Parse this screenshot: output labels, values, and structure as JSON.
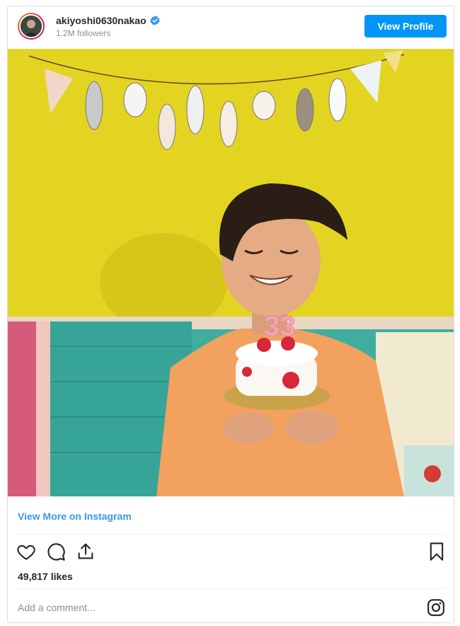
{
  "header": {
    "username": "akiyoshi0630nakao",
    "followers": "1.2M followers",
    "view_profile_label": "View Profile",
    "verified_icon": "verified-badge-icon"
  },
  "post": {
    "image_icon": "photo",
    "view_more_label": "View More on Instagram",
    "likes": "49,817 likes",
    "comment_placeholder": "Add a comment...",
    "action_icons": [
      "heart-icon",
      "comment-icon",
      "share-icon",
      "bookmark-icon"
    ]
  },
  "colors": {
    "accent": "#0095f6",
    "link": "#3897f0",
    "wall": "#e0d21f"
  }
}
